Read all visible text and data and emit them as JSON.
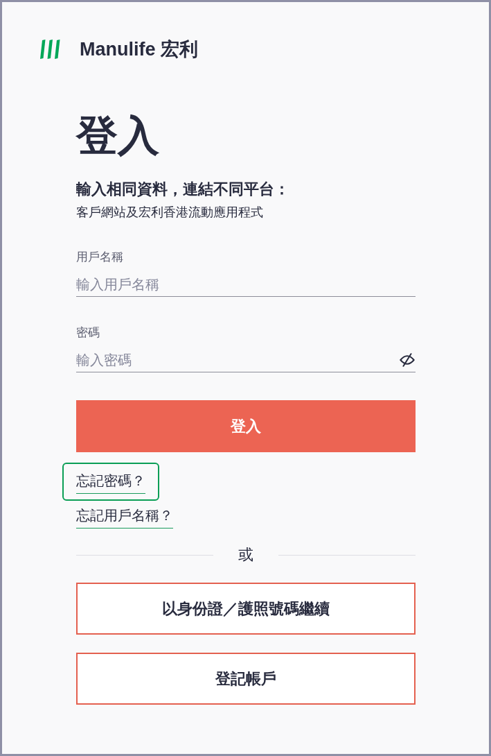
{
  "brand": {
    "name": "Manulife 宏利"
  },
  "intro": {
    "title": "登入",
    "heading": "輸入相同資料，連結不同平台：",
    "subtext": "客戶網站及宏利香港流動應用程式"
  },
  "fields": [
    {
      "kind": "text",
      "label": "用戶名稱",
      "placeholder": "輸入用戶名稱"
    },
    {
      "kind": "password",
      "label": "密碼",
      "placeholder": "輸入密碼",
      "revealed": false
    }
  ],
  "submit_button": "登入",
  "links": [
    {
      "label": "忘記密碼？",
      "focused": true
    },
    {
      "label": "忘記用戶名稱？",
      "focused": false
    }
  ],
  "divider": "或",
  "alt_buttons": [
    "以身份證／護照號碼繼續",
    "登記帳戶"
  ]
}
